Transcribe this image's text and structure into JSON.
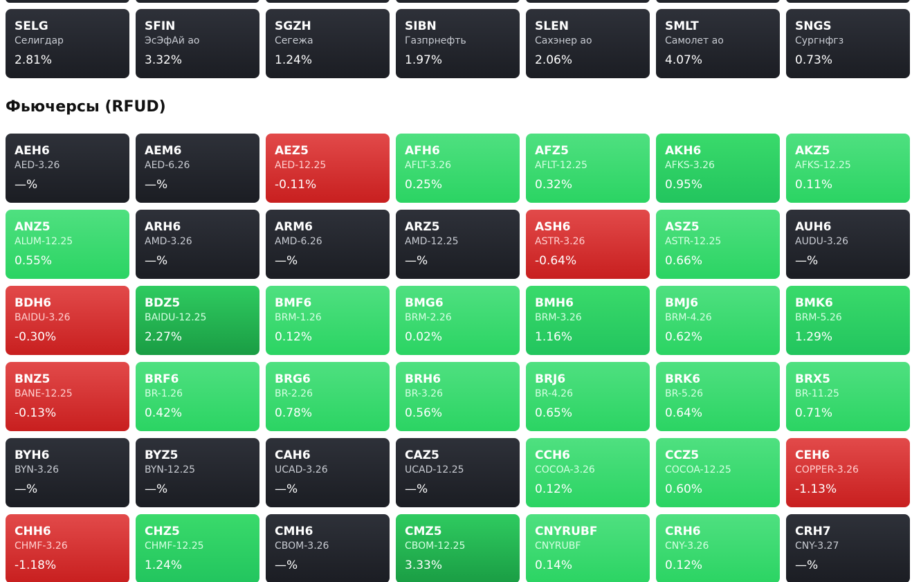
{
  "colors": {
    "neutral": "#24272e",
    "negative": "#d93434",
    "positive_light": "#4ade80",
    "positive": "#22c55e",
    "positive_strong": "#16a34a"
  },
  "stocks": [
    {
      "ticker": "SELG",
      "name": "Селигдар",
      "change": "2.81%",
      "tone": "neutral"
    },
    {
      "ticker": "SFIN",
      "name": "ЭсЭфАй ао",
      "change": "3.32%",
      "tone": "neutral"
    },
    {
      "ticker": "SGZH",
      "name": "Сегежа",
      "change": "1.24%",
      "tone": "neutral"
    },
    {
      "ticker": "SIBN",
      "name": "Газпрнефть",
      "change": "1.97%",
      "tone": "neutral"
    },
    {
      "ticker": "SLEN",
      "name": "Сахэнер ао",
      "change": "2.06%",
      "tone": "neutral"
    },
    {
      "ticker": "SMLT",
      "name": "Самолет ао",
      "change": "4.07%",
      "tone": "neutral"
    },
    {
      "ticker": "SNGS",
      "name": "Сургнфгз",
      "change": "0.73%",
      "tone": "neutral"
    }
  ],
  "futures_section": {
    "title": "Фьючерсы (RFUD)"
  },
  "futures": [
    {
      "ticker": "AEH6",
      "name": "AED-3.26",
      "change": "—%",
      "tone": "neutral"
    },
    {
      "ticker": "AEM6",
      "name": "AED-6.26",
      "change": "—%",
      "tone": "neutral"
    },
    {
      "ticker": "AEZ5",
      "name": "AED-12.25",
      "change": "-0.11%",
      "tone": "red"
    },
    {
      "ticker": "AFH6",
      "name": "AFLT-3.26",
      "change": "0.25%",
      "tone": "g1"
    },
    {
      "ticker": "AFZ5",
      "name": "AFLT-12.25",
      "change": "0.32%",
      "tone": "g1"
    },
    {
      "ticker": "AKH6",
      "name": "AFKS-3.26",
      "change": "0.95%",
      "tone": "g2"
    },
    {
      "ticker": "AKZ5",
      "name": "AFKS-12.25",
      "change": "0.11%",
      "tone": "g1"
    },
    {
      "ticker": "ANZ5",
      "name": "ALUM-12.25",
      "change": "0.55%",
      "tone": "g1"
    },
    {
      "ticker": "ARH6",
      "name": "AMD-3.26",
      "change": "—%",
      "tone": "neutral"
    },
    {
      "ticker": "ARM6",
      "name": "AMD-6.26",
      "change": "—%",
      "tone": "neutral"
    },
    {
      "ticker": "ARZ5",
      "name": "AMD-12.25",
      "change": "—%",
      "tone": "neutral"
    },
    {
      "ticker": "ASH6",
      "name": "ASTR-3.26",
      "change": "-0.64%",
      "tone": "red"
    },
    {
      "ticker": "ASZ5",
      "name": "ASTR-12.25",
      "change": "0.66%",
      "tone": "g1"
    },
    {
      "ticker": "AUH6",
      "name": "AUDU-3.26",
      "change": "—%",
      "tone": "neutral"
    },
    {
      "ticker": "BDH6",
      "name": "BAIDU-3.26",
      "change": "-0.30%",
      "tone": "red"
    },
    {
      "ticker": "BDZ5",
      "name": "BAIDU-12.25",
      "change": "2.27%",
      "tone": "g3"
    },
    {
      "ticker": "BMF6",
      "name": "BRM-1.26",
      "change": "0.12%",
      "tone": "g1"
    },
    {
      "ticker": "BMG6",
      "name": "BRM-2.26",
      "change": "0.02%",
      "tone": "g1"
    },
    {
      "ticker": "BMH6",
      "name": "BRM-3.26",
      "change": "1.16%",
      "tone": "g2"
    },
    {
      "ticker": "BMJ6",
      "name": "BRM-4.26",
      "change": "0.62%",
      "tone": "g1"
    },
    {
      "ticker": "BMK6",
      "name": "BRM-5.26",
      "change": "1.29%",
      "tone": "g2"
    },
    {
      "ticker": "BNZ5",
      "name": "BANE-12.25",
      "change": "-0.13%",
      "tone": "red"
    },
    {
      "ticker": "BRF6",
      "name": "BR-1.26",
      "change": "0.42%",
      "tone": "g1"
    },
    {
      "ticker": "BRG6",
      "name": "BR-2.26",
      "change": "0.78%",
      "tone": "g1"
    },
    {
      "ticker": "BRH6",
      "name": "BR-3.26",
      "change": "0.56%",
      "tone": "g1"
    },
    {
      "ticker": "BRJ6",
      "name": "BR-4.26",
      "change": "0.65%",
      "tone": "g1"
    },
    {
      "ticker": "BRK6",
      "name": "BR-5.26",
      "change": "0.64%",
      "tone": "g1"
    },
    {
      "ticker": "BRX5",
      "name": "BR-11.25",
      "change": "0.71%",
      "tone": "g1"
    },
    {
      "ticker": "BYH6",
      "name": "BYN-3.26",
      "change": "—%",
      "tone": "neutral"
    },
    {
      "ticker": "BYZ5",
      "name": "BYN-12.25",
      "change": "—%",
      "tone": "neutral"
    },
    {
      "ticker": "CAH6",
      "name": "UCAD-3.26",
      "change": "—%",
      "tone": "neutral"
    },
    {
      "ticker": "CAZ5",
      "name": "UCAD-12.25",
      "change": "—%",
      "tone": "neutral"
    },
    {
      "ticker": "CCH6",
      "name": "COCOA-3.26",
      "change": "0.12%",
      "tone": "g1"
    },
    {
      "ticker": "CCZ5",
      "name": "COCOA-12.25",
      "change": "0.60%",
      "tone": "g1"
    },
    {
      "ticker": "CEH6",
      "name": "COPPER-3.26",
      "change": "-1.13%",
      "tone": "red"
    },
    {
      "ticker": "CHH6",
      "name": "CHMF-3.26",
      "change": "-1.18%",
      "tone": "red"
    },
    {
      "ticker": "CHZ5",
      "name": "CHMF-12.25",
      "change": "1.24%",
      "tone": "g2"
    },
    {
      "ticker": "CMH6",
      "name": "CBOM-3.26",
      "change": "—%",
      "tone": "neutral"
    },
    {
      "ticker": "CMZ5",
      "name": "CBOM-12.25",
      "change": "3.33%",
      "tone": "g3"
    },
    {
      "ticker": "CNYRUBF",
      "name": "CNYRUBF",
      "change": "0.14%",
      "tone": "g1"
    },
    {
      "ticker": "CRH6",
      "name": "CNY-3.26",
      "change": "0.12%",
      "tone": "g1"
    },
    {
      "ticker": "CRH7",
      "name": "CNY-3.27",
      "change": "—%",
      "tone": "neutral"
    }
  ]
}
